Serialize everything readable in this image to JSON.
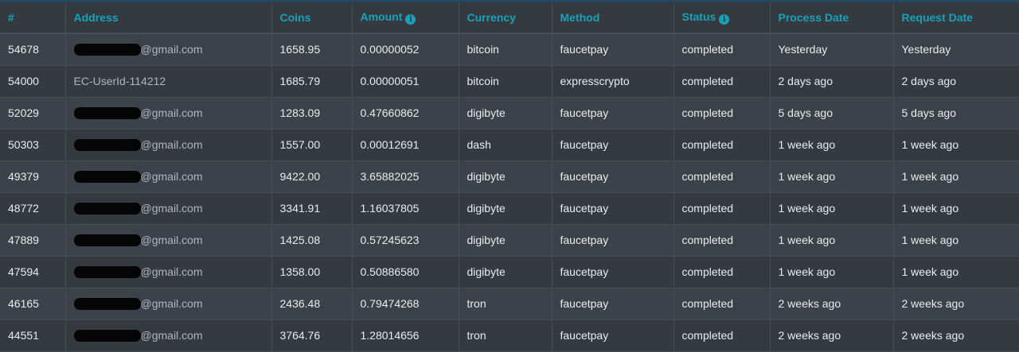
{
  "table": {
    "headers": {
      "id": "#",
      "address": "Address",
      "coins": "Coins",
      "amount": "Amount",
      "currency": "Currency",
      "method": "Method",
      "status": "Status",
      "process_date": "Process Date",
      "request_date": "Request Date"
    },
    "header_icons": {
      "amount": "info-circle-icon",
      "status": "info-circle-icon"
    },
    "rows": [
      {
        "id": "54678",
        "address": "@gmail.com",
        "redacted": true,
        "coins": "1658.95",
        "amount": "0.00000052",
        "currency": "bitcoin",
        "method": "faucetpay",
        "status": "completed",
        "process_date": "Yesterday",
        "request_date": "Yesterday"
      },
      {
        "id": "54000",
        "address": "EC-UserId-114212",
        "redacted": false,
        "coins": "1685.79",
        "amount": "0.00000051",
        "currency": "bitcoin",
        "method": "expresscrypto",
        "status": "completed",
        "process_date": "2 days ago",
        "request_date": "2 days ago"
      },
      {
        "id": "52029",
        "address": "@gmail.com",
        "redacted": true,
        "coins": "1283.09",
        "amount": "0.47660862",
        "currency": "digibyte",
        "method": "faucetpay",
        "status": "completed",
        "process_date": "5 days ago",
        "request_date": "5 days ago"
      },
      {
        "id": "50303",
        "address": "@gmail.com",
        "redacted": true,
        "coins": "1557.00",
        "amount": "0.00012691",
        "currency": "dash",
        "method": "faucetpay",
        "status": "completed",
        "process_date": "1 week ago",
        "request_date": "1 week ago"
      },
      {
        "id": "49379",
        "address": "@gmail.com",
        "redacted": true,
        "coins": "9422.00",
        "amount": "3.65882025",
        "currency": "digibyte",
        "method": "faucetpay",
        "status": "completed",
        "process_date": "1 week ago",
        "request_date": "1 week ago"
      },
      {
        "id": "48772",
        "address": "@gmail.com",
        "redacted": true,
        "coins": "3341.91",
        "amount": "1.16037805",
        "currency": "digibyte",
        "method": "faucetpay",
        "status": "completed",
        "process_date": "1 week ago",
        "request_date": "1 week ago"
      },
      {
        "id": "47889",
        "address": "@gmail.com",
        "redacted": true,
        "coins": "1425.08",
        "amount": "0.57245623",
        "currency": "digibyte",
        "method": "faucetpay",
        "status": "completed",
        "process_date": "1 week ago",
        "request_date": "1 week ago"
      },
      {
        "id": "47594",
        "address": "@gmail.com",
        "redacted": true,
        "coins": "1358.00",
        "amount": "0.50886580",
        "currency": "digibyte",
        "method": "faucetpay",
        "status": "completed",
        "process_date": "1 week ago",
        "request_date": "1 week ago"
      },
      {
        "id": "46165",
        "address": "@gmail.com",
        "redacted": true,
        "coins": "2436.48",
        "amount": "0.79474268",
        "currency": "tron",
        "method": "faucetpay",
        "status": "completed",
        "process_date": "2 weeks ago",
        "request_date": "2 weeks ago"
      },
      {
        "id": "44551",
        "address": "@gmail.com",
        "redacted": true,
        "coins": "3764.76",
        "amount": "1.28014656",
        "currency": "tron",
        "method": "faucetpay",
        "status": "completed",
        "process_date": "2 weeks ago",
        "request_date": "2 weeks ago"
      }
    ]
  },
  "colors": {
    "background": "#343a40",
    "row_alt": "#3c4249",
    "header_text": "#17a2b8",
    "body_text": "#e9ecef",
    "redaction": "#050505"
  }
}
